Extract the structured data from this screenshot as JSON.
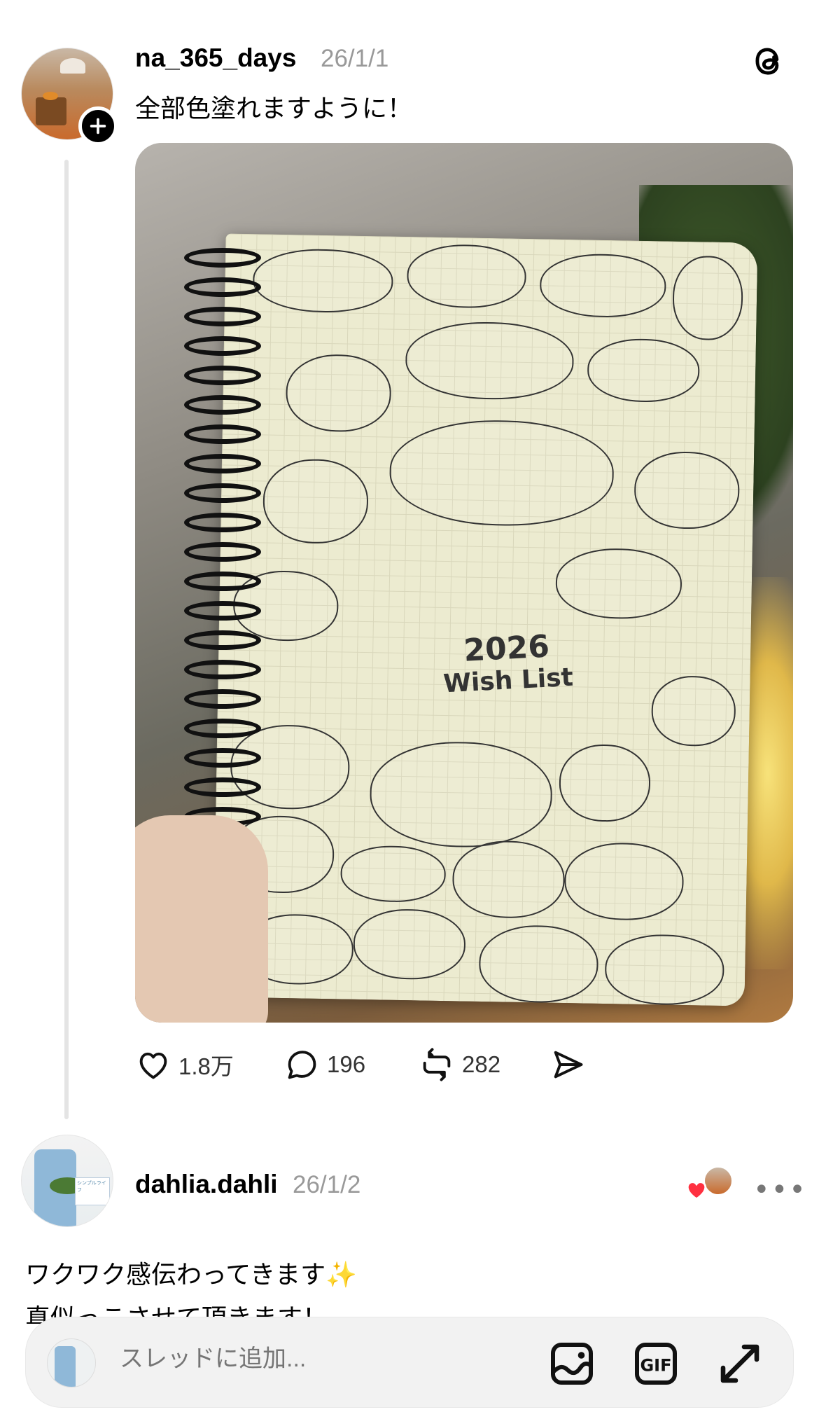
{
  "post": {
    "username": "na_365_days",
    "date": "26/1/1",
    "caption": "全部色塗れますように！",
    "image_text": {
      "title_main": "2026",
      "title_sub": "Wish List"
    },
    "actions": {
      "likes": "1.8万",
      "comments": "196",
      "reposts": "282"
    }
  },
  "reply": {
    "username": "dahlia.dahli",
    "date": "26/1/2",
    "text_line1": "ワクワク感伝わってきます✨",
    "text_line2": "真似っこさせて頂きます！"
  },
  "composer": {
    "placeholder": "スレッドに追加..."
  },
  "colors": {
    "accent_heart": "#ff3040",
    "secondary_text": "#999999",
    "thread_line": "#e4e4e4"
  },
  "icons": [
    "follow-plus-icon",
    "threads-logo-icon",
    "heart-icon",
    "comment-icon",
    "repost-icon",
    "share-icon",
    "more-icon",
    "image-icon",
    "gif-icon",
    "expand-icon"
  ]
}
